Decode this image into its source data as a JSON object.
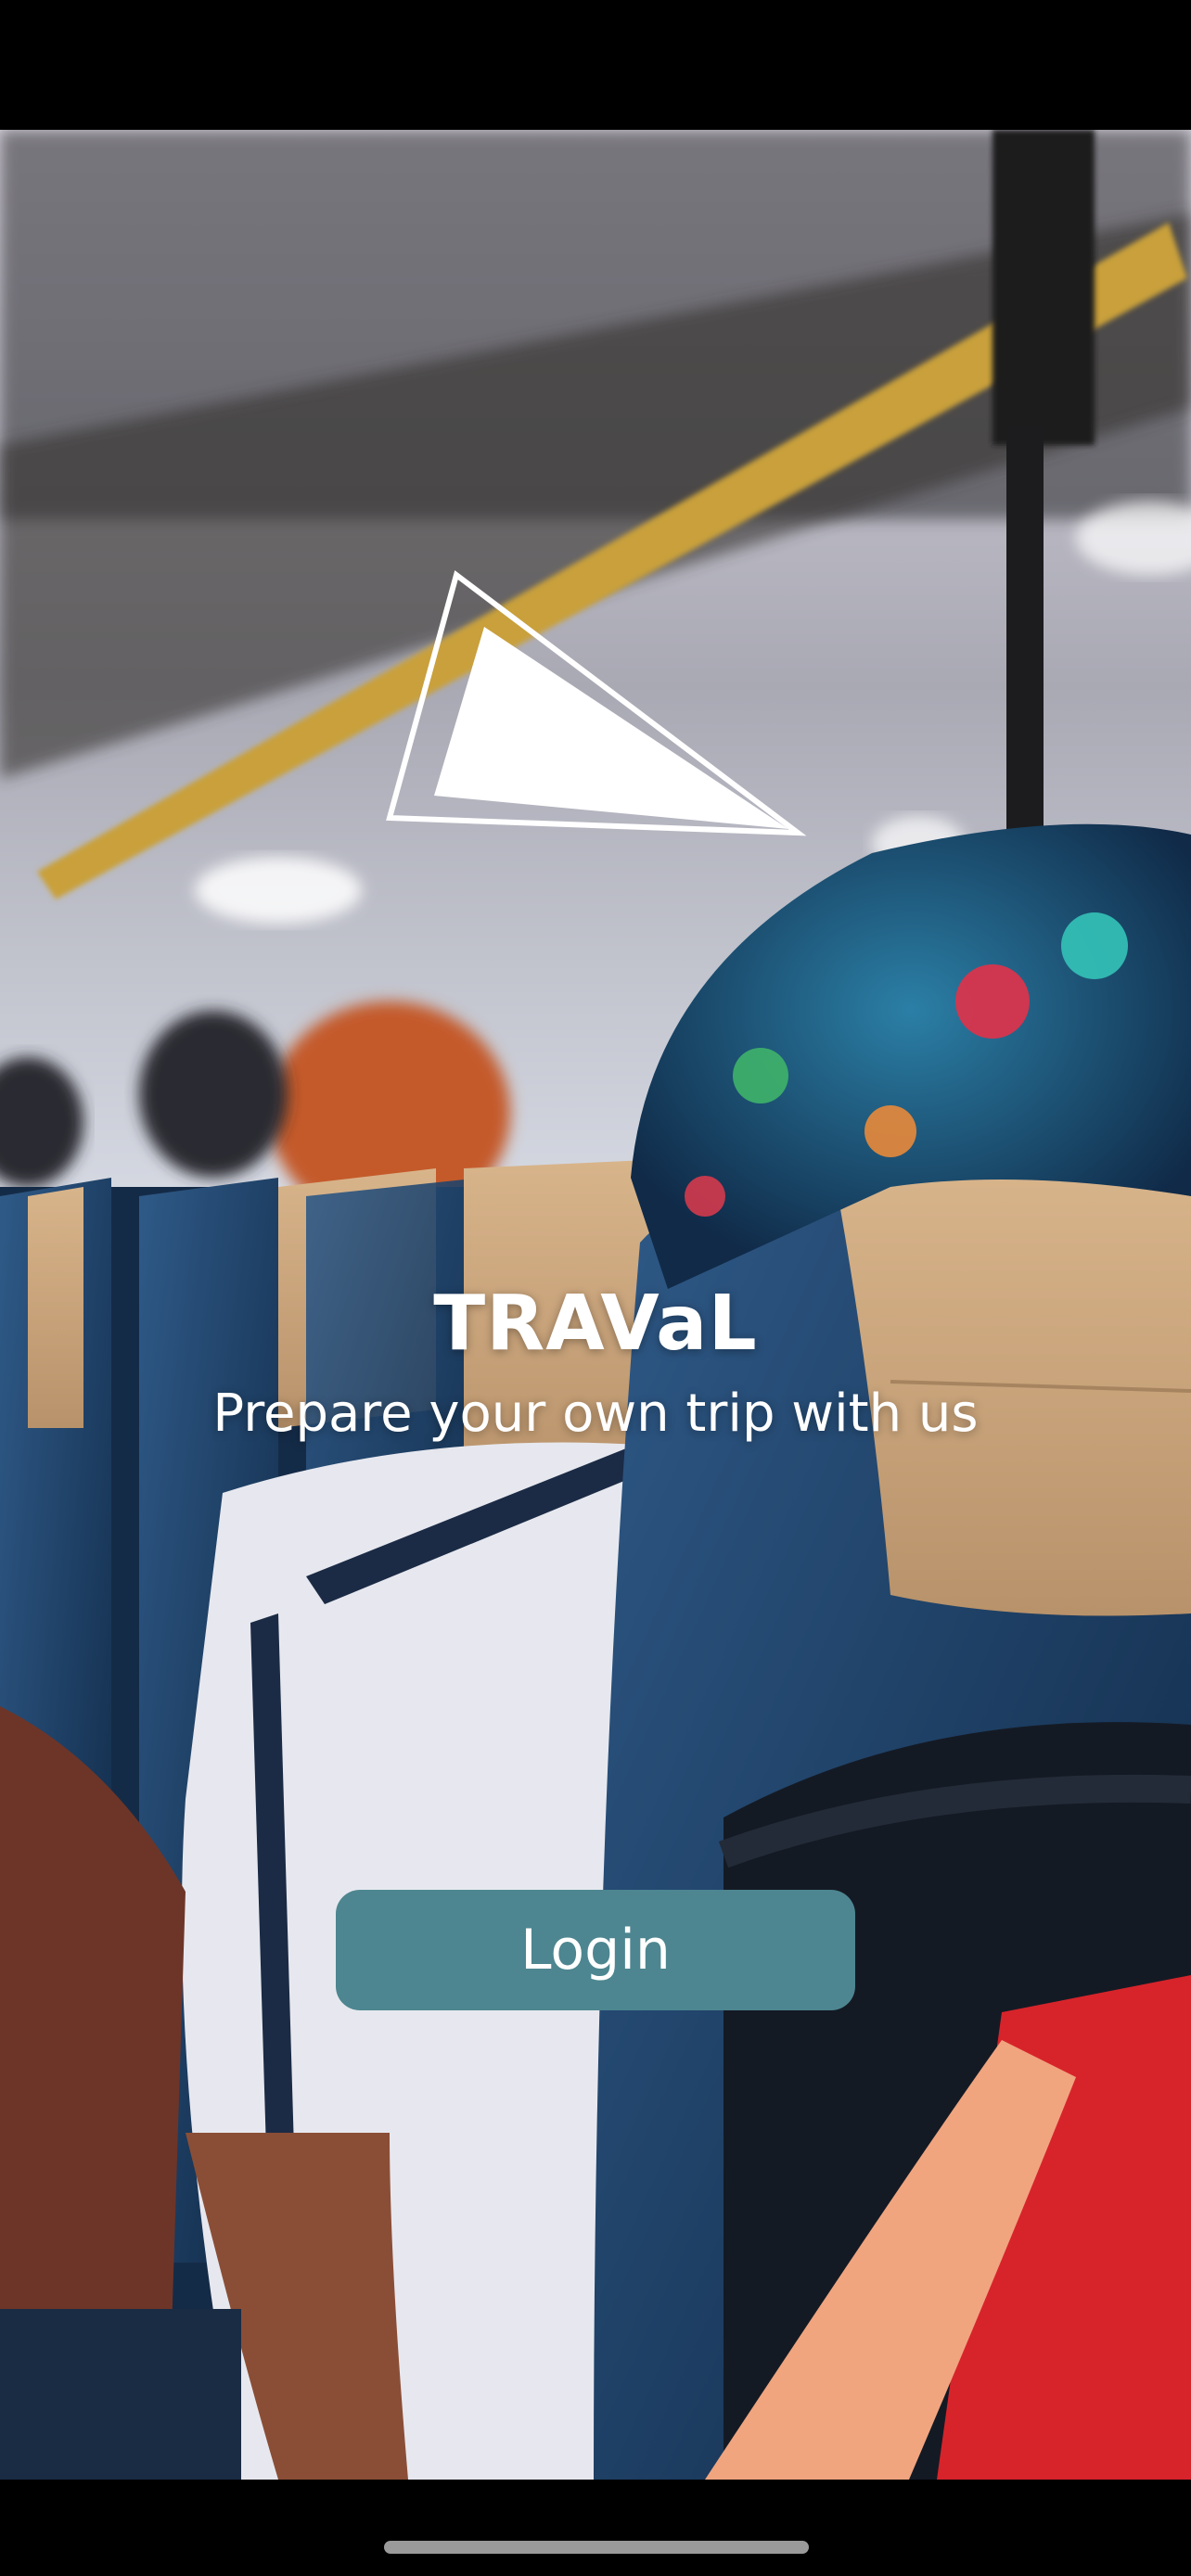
{
  "app": {
    "title": "TRAVaL",
    "subtitle": "Prepare your own trip with us"
  },
  "actions": {
    "login_label": "Login"
  },
  "icons": {
    "logo": "paper-plane-triangle-icon",
    "background": "bus-interior-photo"
  },
  "colors": {
    "button": "#4d8690",
    "text": "#ffffff",
    "status_bar": "#000000"
  }
}
